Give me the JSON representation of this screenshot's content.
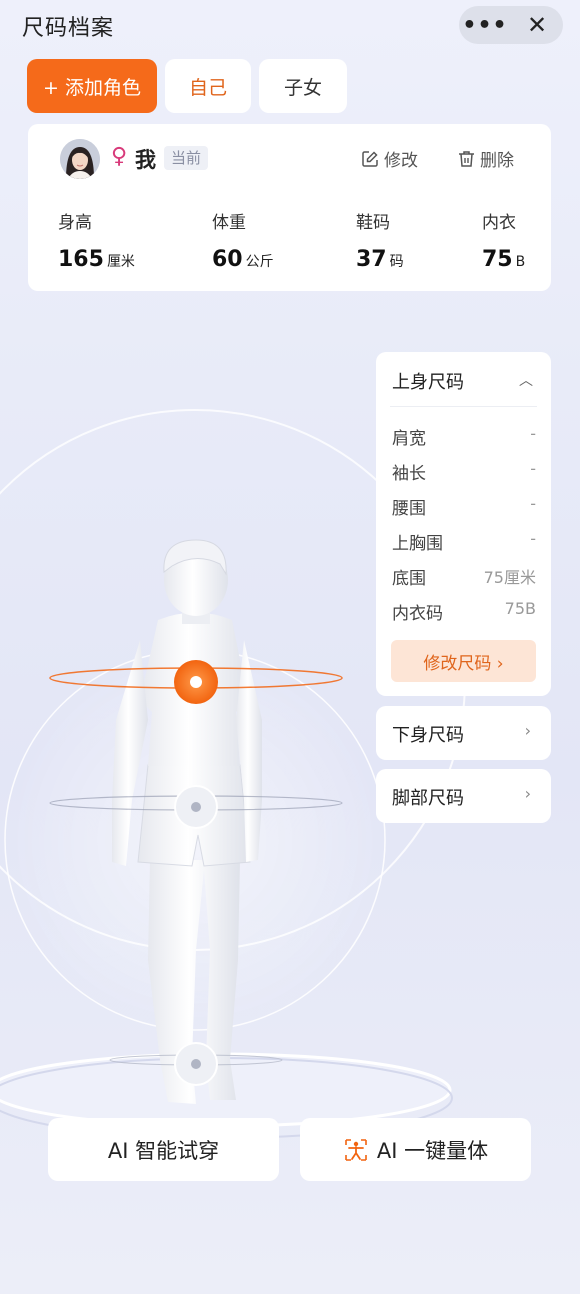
{
  "header": {
    "title": "尺码档案",
    "more": "•••",
    "close": "✕"
  },
  "tabs": {
    "add": "+ 添加角色",
    "self": "自己",
    "child": "子女"
  },
  "profile": {
    "gender_symbol": "♀",
    "name": "我",
    "current_badge": "当前",
    "edit_label": "修改",
    "delete_label": "删除",
    "stats": [
      {
        "label": "身高",
        "value": "165",
        "unit": "厘米"
      },
      {
        "label": "体重",
        "value": "60",
        "unit": "公斤"
      },
      {
        "label": "鞋码",
        "value": "37",
        "unit": "码"
      },
      {
        "label": "内衣",
        "value": "75",
        "unit": "B"
      }
    ]
  },
  "upper_body": {
    "title": "上身尺码",
    "rows": [
      {
        "label": "肩宽",
        "value": "-"
      },
      {
        "label": "袖长",
        "value": "-"
      },
      {
        "label": "腰围",
        "value": "-"
      },
      {
        "label": "上胸围",
        "value": "-"
      },
      {
        "label": "底围",
        "value": "75厘米"
      },
      {
        "label": "内衣码",
        "value": "75B"
      }
    ],
    "modify_label": "修改尺码 ›"
  },
  "lower_body": {
    "title": "下身尺码"
  },
  "foot": {
    "title": "脚部尺码"
  },
  "buttons": {
    "try_on": "AI 智能试穿",
    "measure": "AI 一键量体"
  },
  "colors": {
    "accent": "#f56a1a",
    "accent_light": "#fde5d6",
    "background": "#e8ebf8"
  }
}
